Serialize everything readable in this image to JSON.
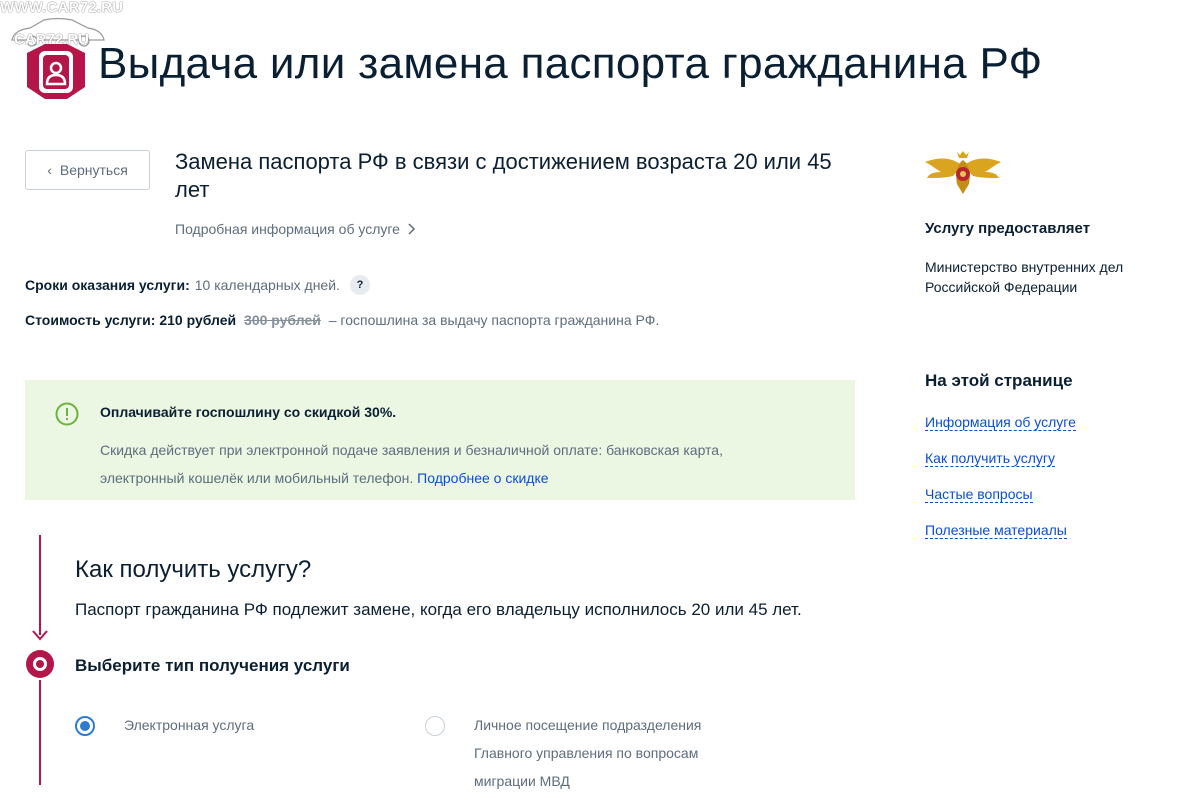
{
  "watermark": {
    "site": "WWW.CAR72.RU",
    "logo_text": "CAR72.RU"
  },
  "header": {
    "title": "Выдача или замена паспорта гражданина РФ"
  },
  "back_button": {
    "label": "Вернуться"
  },
  "service": {
    "title": "Замена паспорта РФ в связи с достижением возраста 20 или 45 лет",
    "details_link": "Подробная информация об услуге"
  },
  "terms": {
    "label": "Сроки оказания услуги:",
    "value": "10 календарных дней.",
    "help": "?"
  },
  "cost": {
    "label": "Стоимость услуги:",
    "price": "210 рублей",
    "old_price": "300 рублей",
    "description": "– госпошлина за выдачу паспорта гражданина РФ."
  },
  "notice": {
    "icon": "exclamation-circle-icon",
    "heading": "Оплачивайте госпошлину со скидкой 30%.",
    "body": "Скидка действует при электронной подаче заявления и безналичной оплате: банковская карта, электронный кошелёк или мобильный телефон.",
    "link": "Подробнее о скидке",
    "bg_color": "#ebf6e3",
    "icon_color": "#6cb33f"
  },
  "how": {
    "title": "Как получить услугу?",
    "description": "Паспорт гражданина РФ подлежит замене, когда его владельцу исполнилось 20 или 45 лет."
  },
  "step": {
    "title": "Выберите тип получения услуги",
    "accent_color": "#b5164a",
    "options": [
      {
        "label": "Электронная услуга",
        "selected": true
      },
      {
        "label": "Личное посещение подразделения Главного управления по вопросам миграции МВД",
        "selected": false
      }
    ]
  },
  "sidebar": {
    "emblem_icon": "mvd-eagle-emblem-icon",
    "provider_heading": "Услугу предоставляет",
    "provider_name": "Министерство внутренних дел Российской Федерации",
    "on_page_heading": "На этой странице",
    "toc": [
      "Информация об услуге",
      "Как получить услугу",
      "Частые вопросы",
      "Полезные материалы"
    ]
  }
}
